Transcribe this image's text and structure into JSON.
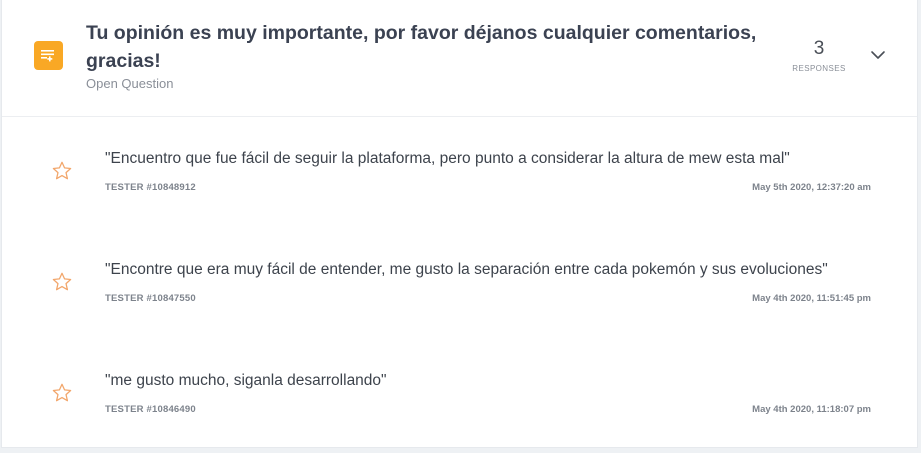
{
  "question": {
    "title": "Tu opinión es muy importante, por favor déjanos cualquier comentarios, gracias!",
    "type_label": "Open Question",
    "type_icon": "text-lines-icon",
    "responses_count": "3",
    "responses_label": "RESPONSES"
  },
  "colors": {
    "accent": "#f9a825",
    "star": "#f2a66b"
  },
  "responses": [
    {
      "text": "\"Encuentro que fue fácil de seguir la plataforma, pero punto a considerar la altura de mew esta mal\"",
      "tester": "TESTER #10848912",
      "date": "May 5th 2020, 12:37:20 am"
    },
    {
      "text": "\"Encontre que era muy fácil de entender, me gusto la separación entre cada pokemón y sus evoluciones\"",
      "tester": "TESTER #10847550",
      "date": "May 4th 2020, 11:51:45 pm"
    },
    {
      "text": "\"me gusto mucho, siganla desarrollando\"",
      "tester": "TESTER #10846490",
      "date": "May 4th 2020, 11:18:07 pm"
    }
  ]
}
